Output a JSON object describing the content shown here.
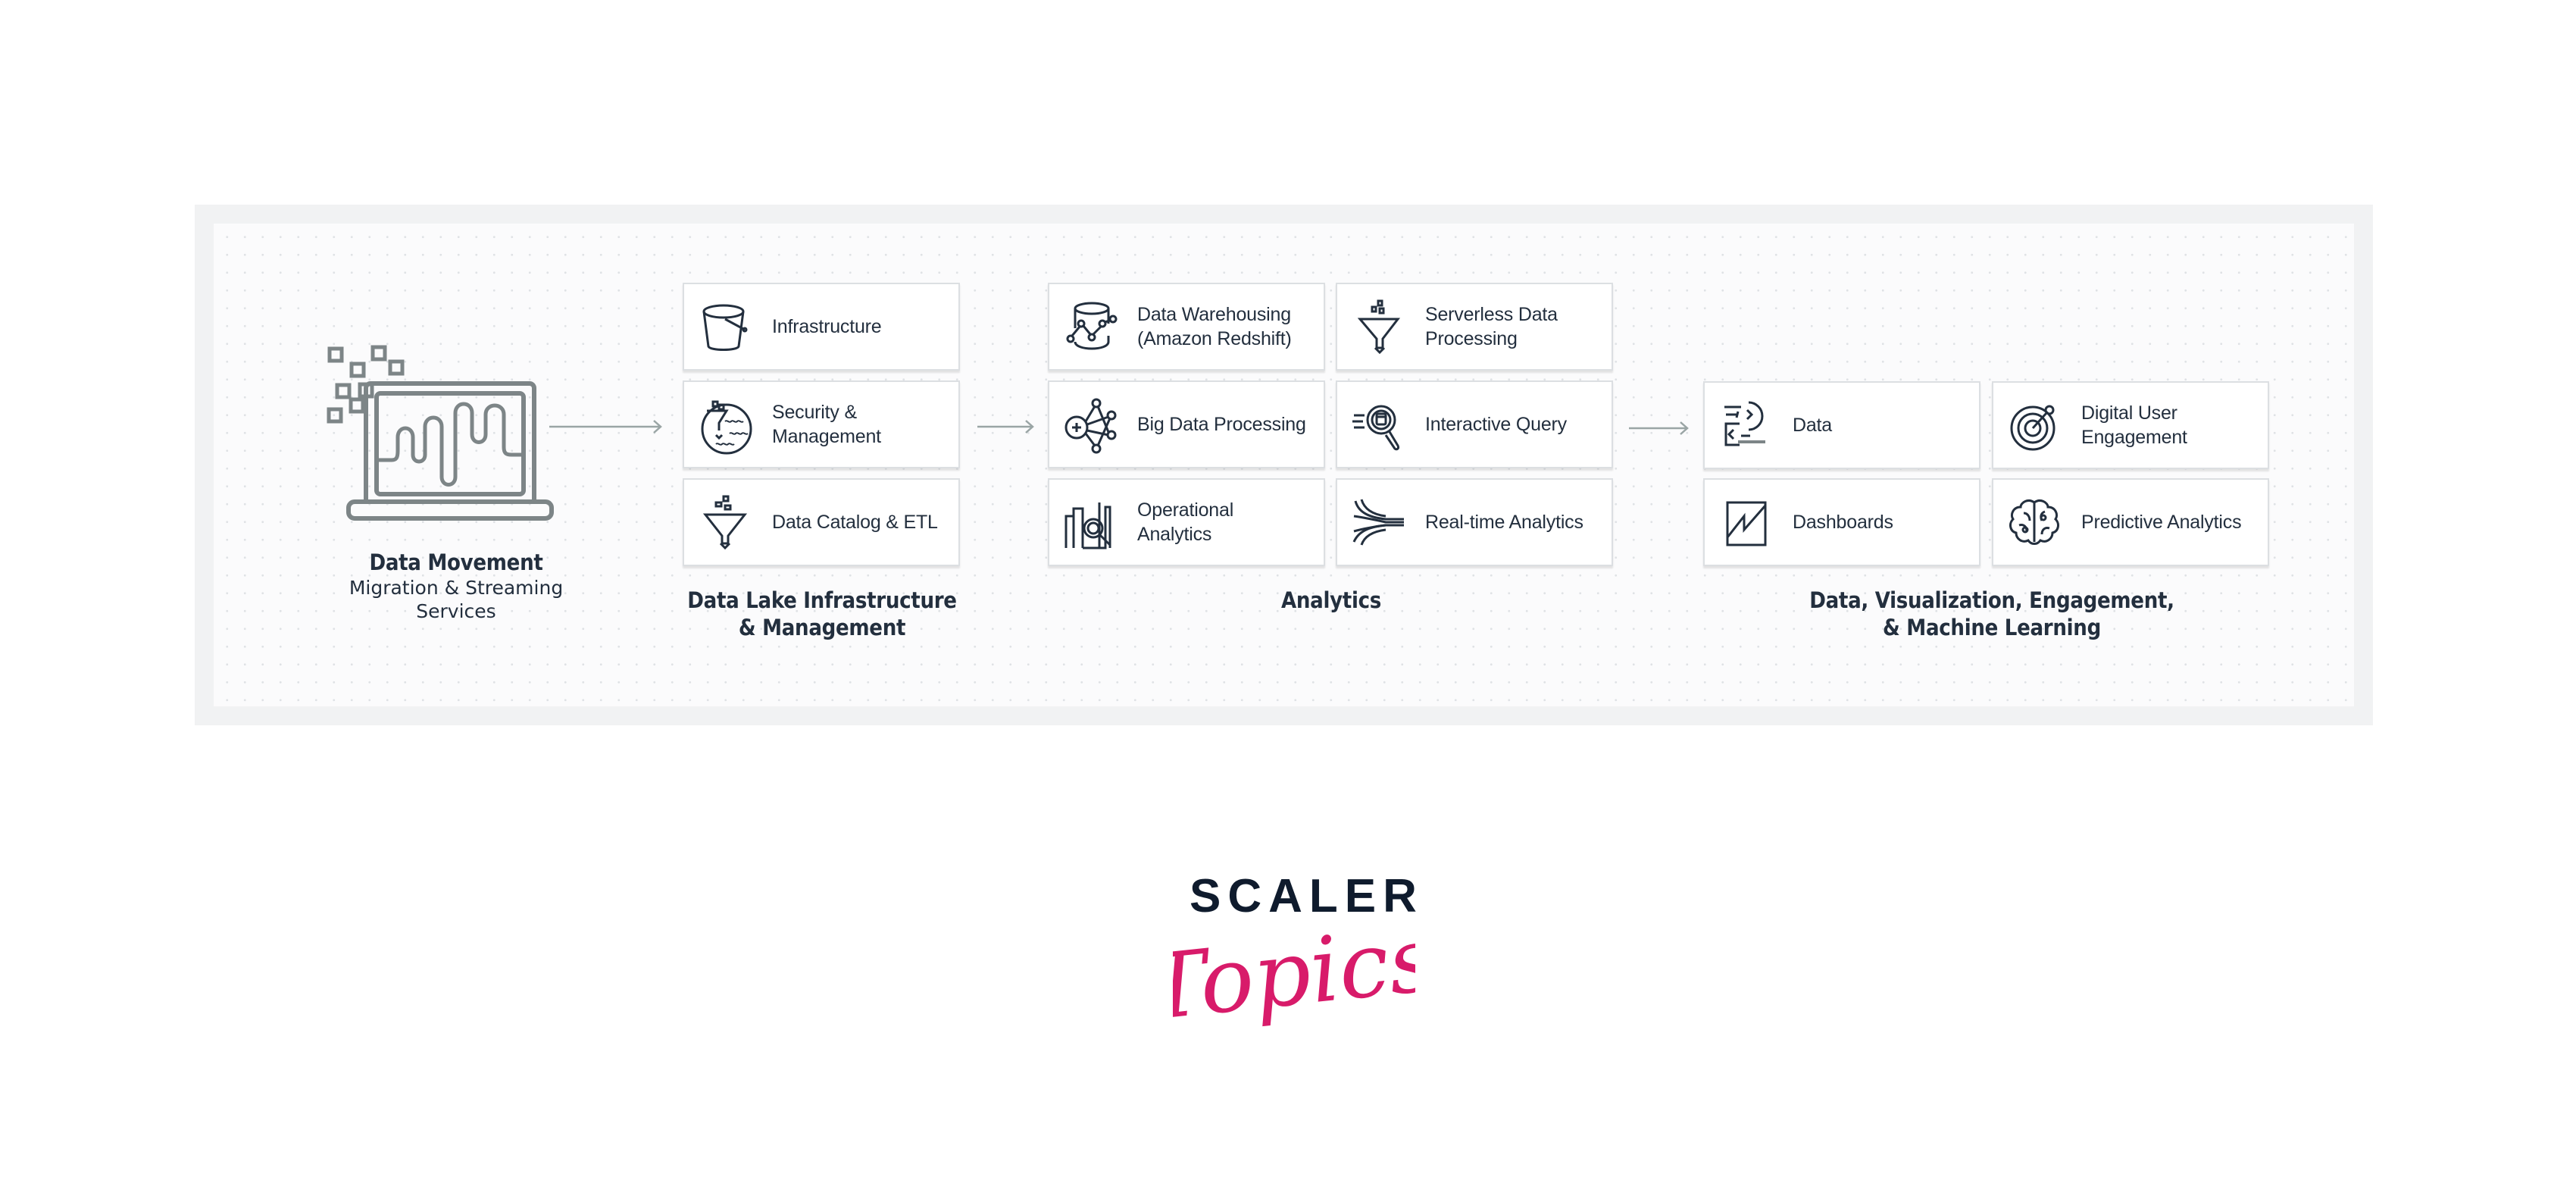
{
  "diagram": {
    "colors": {
      "text": "#232f3e",
      "icon_stroke": "#232f3e",
      "arrow": "#9aa5a5",
      "laptop_gray": "#7d8587",
      "frame": "#f1f2f3",
      "card_border": "#dcdfe2"
    },
    "source": {
      "icon": "laptop-waveform-icon",
      "title": "Data Movement",
      "subtitle": "Migration & Streaming\nServices"
    },
    "groups": [
      {
        "caption": "Data Lake Infrastructure\n& Management",
        "items": [
          {
            "label": "Infrastructure",
            "icon": "bucket-icon"
          },
          {
            "label": "Security &\nManagement",
            "icon": "security-filter-icon"
          },
          {
            "label": "Data Catalog & ETL",
            "icon": "funnel-icon"
          }
        ]
      },
      {
        "caption": "Analytics",
        "items": [
          {
            "label": "Data Warehousing\n(Amazon Redshift)",
            "icon": "database-graph-icon"
          },
          {
            "label": "Serverless Data\nProcessing",
            "icon": "funnel-icon"
          },
          {
            "label": "Big Data Processing",
            "icon": "network-nodes-icon"
          },
          {
            "label": "Interactive Query",
            "icon": "magnifier-query-icon"
          },
          {
            "label": "Operational\nAnalytics",
            "icon": "building-search-icon"
          },
          {
            "label": "Real-time Analytics",
            "icon": "stream-lines-icon"
          }
        ]
      },
      {
        "caption": "Data, Visualization, Engagement,\n& Machine Learning",
        "items": [
          {
            "label": "Data",
            "icon": "code-data-icon"
          },
          {
            "label": "Digital User\nEngagement",
            "icon": "target-icon"
          },
          {
            "label": "Dashboards",
            "icon": "chart-line-icon"
          },
          {
            "label": "Predictive Analytics",
            "icon": "brain-icon"
          }
        ]
      }
    ]
  },
  "logo": {
    "line1": "SCALER",
    "line2": "Topics",
    "colors": {
      "line1": "#0f1b2d",
      "line2": "#d81b6a"
    }
  }
}
